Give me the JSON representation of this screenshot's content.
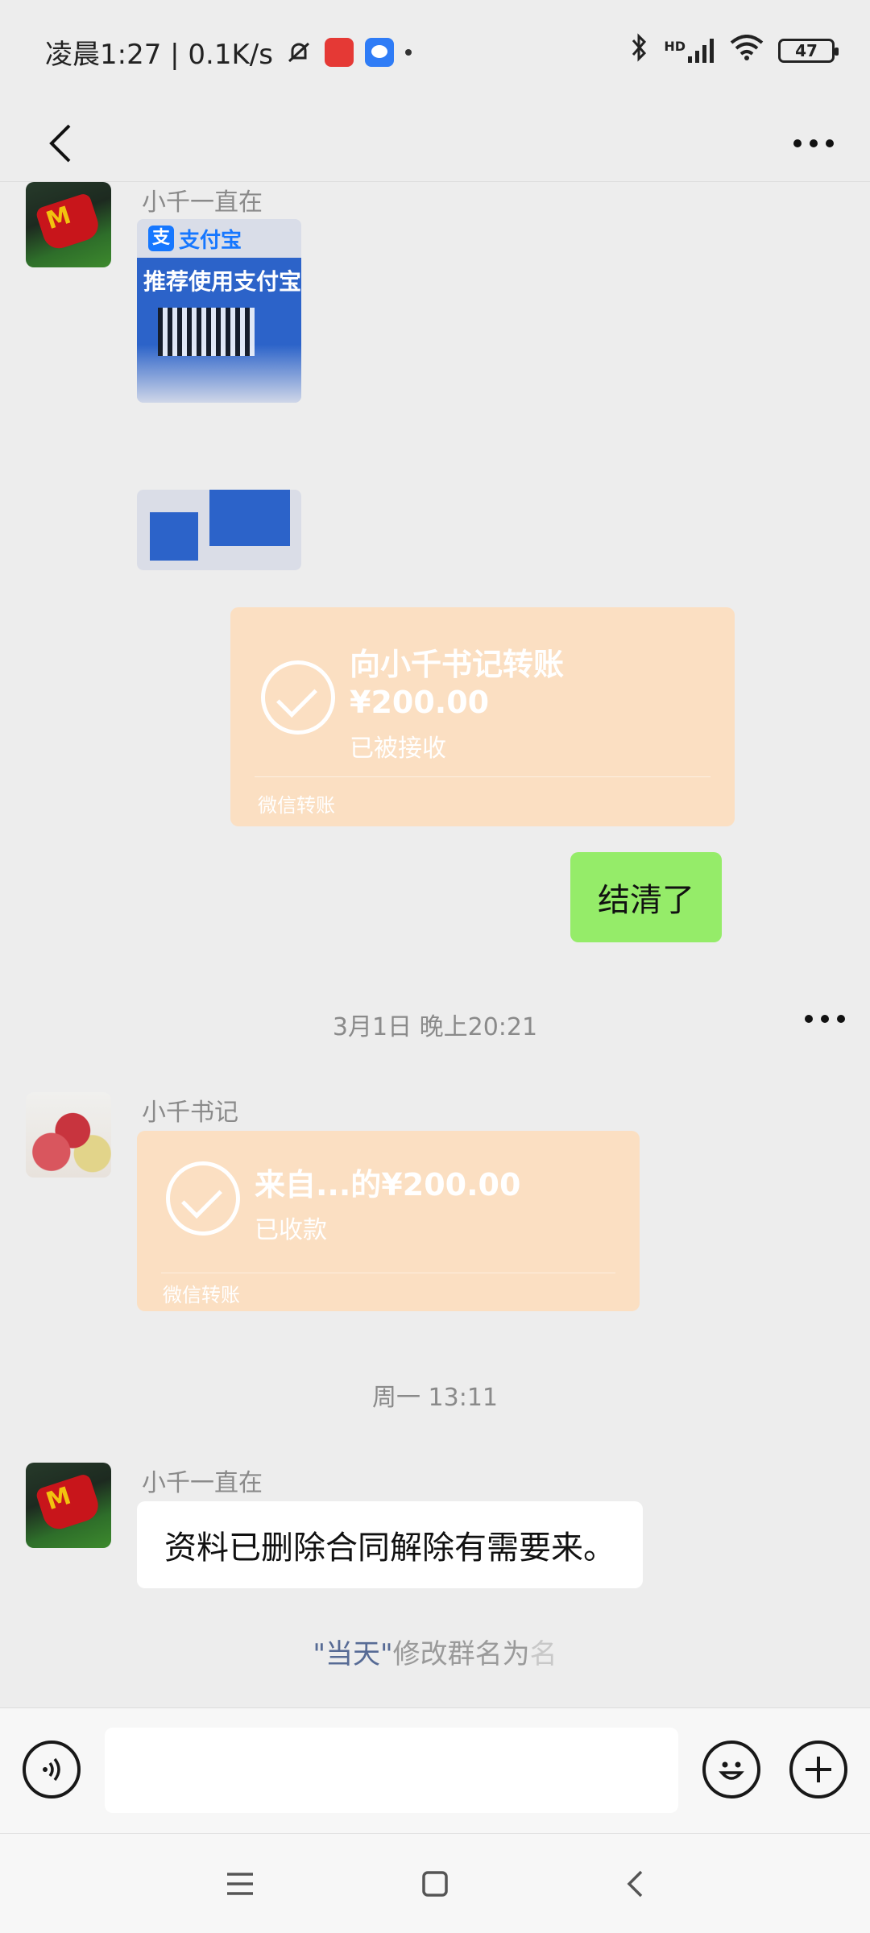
{
  "status_bar": {
    "time_speed": "凌晨1:27 | 0.1K/s",
    "battery": "47",
    "network": "HD"
  },
  "header": {
    "title": "",
    "back_icon": "chevron-left-icon",
    "more_icon": "more-dots-icon"
  },
  "messages": {
    "m1": {
      "sender": "小千一直在",
      "type": "image",
      "img_text_top": "支付宝",
      "img_text_body": "推荐使用支付宝"
    },
    "m2": {
      "type": "transfer-sent",
      "title": "向小千书记转账",
      "amount": "¥200.00",
      "status": "已被接收",
      "footer": "微信转账"
    },
    "m3": {
      "type": "text-sent",
      "text": "结清了"
    },
    "ts1": "3月1日 晚上20:21",
    "m4": {
      "sender": "小千书记",
      "type": "transfer-received",
      "title": "来自...的¥200.00",
      "status": "已收款",
      "footer": "微信转账"
    },
    "ts2": "周一 13:11",
    "m5": {
      "sender": "小千一直在",
      "type": "text",
      "text": "资料已删除合同解除有需要来。"
    },
    "sys": {
      "quoted": "\"当天\"",
      "rest": "修改群名为",
      "trail": "名"
    }
  },
  "input_bar": {
    "placeholder": "",
    "voice_icon": "voice-icon",
    "emoji_icon": "emoji-icon",
    "plus_icon": "plus-icon"
  },
  "system_nav": {
    "menu_icon": "menu-icon",
    "home_icon": "home-icon",
    "back_icon": "back-icon"
  },
  "colors": {
    "background": "#ededed",
    "transfer": "#fbdfc2",
    "sent_bubble": "#95ec69",
    "link": "#576b95"
  }
}
